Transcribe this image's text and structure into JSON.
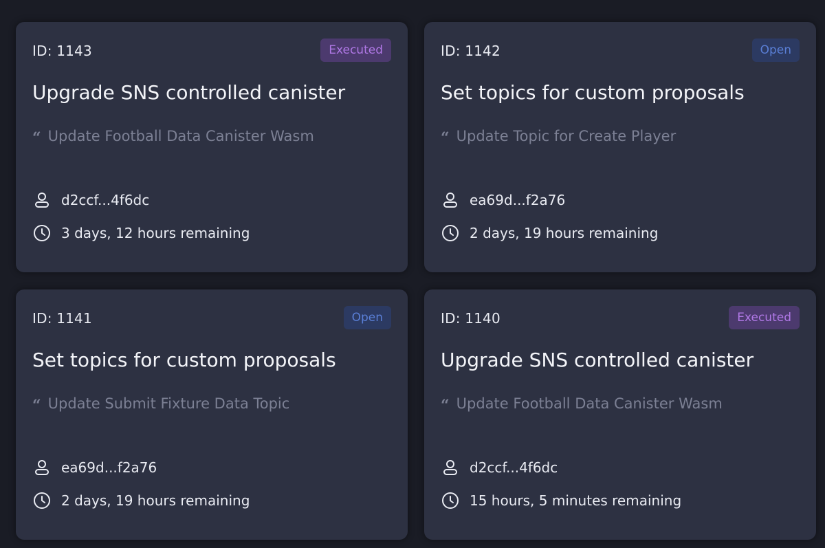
{
  "proposals": [
    {
      "id_label": "ID: 1143",
      "status": "Executed",
      "title": "Upgrade SNS controlled canister",
      "summary": "Update Football Data Canister Wasm",
      "proposer": "d2ccf...4f6dc",
      "remaining": "3 days, 12 hours remaining"
    },
    {
      "id_label": "ID: 1142",
      "status": "Open",
      "title": "Set topics for custom proposals",
      "summary": "Update Topic for Create Player",
      "proposer": "ea69d...f2a76",
      "remaining": "2 days, 19 hours remaining"
    },
    {
      "id_label": "ID: 1141",
      "status": "Open",
      "title": "Set topics for custom proposals",
      "summary": "Update Submit Fixture Data Topic",
      "proposer": "ea69d...f2a76",
      "remaining": "2 days, 19 hours remaining"
    },
    {
      "id_label": "ID: 1140",
      "status": "Executed",
      "title": "Upgrade SNS controlled canister",
      "summary": "Update Football Data Canister Wasm",
      "proposer": "d2ccf...4f6dc",
      "remaining": "15 hours, 5 minutes remaining"
    }
  ],
  "icons": {
    "summary": "quote-icon",
    "proposer": "user-icon",
    "remaining": "clock-icon"
  },
  "colors": {
    "background": "#1a1c25",
    "card": "#2d3142",
    "executed_badge_bg": "#4c3a6e",
    "executed_badge_text": "#b078e6",
    "open_badge_bg": "#2c3a62",
    "open_badge_text": "#5a7fd6"
  }
}
